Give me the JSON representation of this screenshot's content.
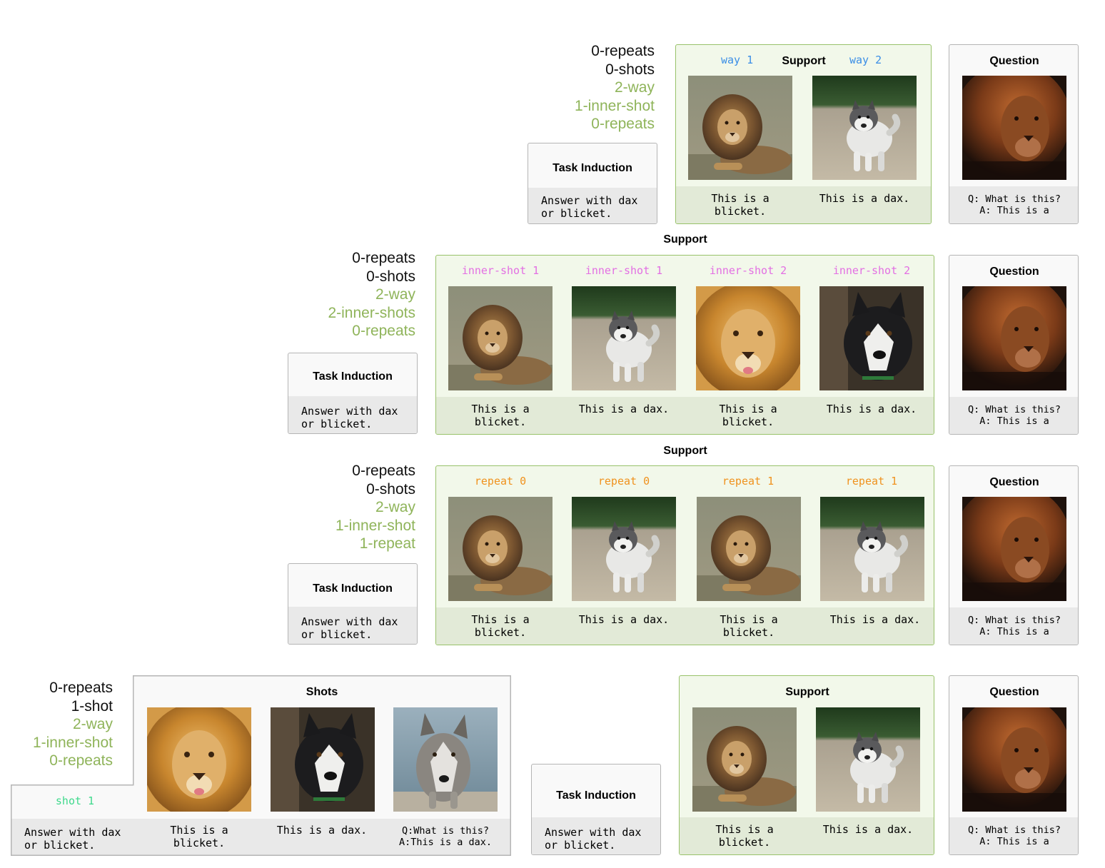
{
  "labels": {
    "support": "Support",
    "question": "Question",
    "task_induction": "Task Induction",
    "shots": "Shots"
  },
  "texts": {
    "task_induction_text": "Answer with dax\nor blicket.",
    "blicket": "This is a\nblicket.",
    "dax": "This is a dax.",
    "question_text": "Q: What is this?\nA: This is a",
    "shot_question": "Q:What is this?\nA:This is a dax."
  },
  "rows": [
    {
      "config": [
        "0-repeats",
        "0-shots",
        "2-way",
        "1-inner-shot",
        "0-repeats"
      ],
      "tags": [
        "way 1",
        "way 2"
      ]
    },
    {
      "config": [
        "0-repeats",
        "0-shots",
        "2-way",
        "2-inner-shots",
        "0-repeats"
      ],
      "tags": [
        "inner-shot 1",
        "inner-shot 1",
        "inner-shot 2",
        "inner-shot 2"
      ]
    },
    {
      "config": [
        "0-repeats",
        "0-shots",
        "2-way",
        "1-inner-shot",
        "1-repeat"
      ],
      "tags": [
        "repeat 0",
        "repeat 0",
        "repeat 1",
        "repeat 1"
      ]
    },
    {
      "config": [
        "0-repeats",
        "1-shot",
        "2-way",
        "1-inner-shot",
        "0-repeats"
      ],
      "tags": [
        "shot 1"
      ]
    }
  ],
  "images": {
    "lion_sitting": "lion-sitting-image",
    "husky_standing": "husky-standing-image",
    "lion_closeup": "lion-closeup-image",
    "husky_portrait": "husky-portrait-image",
    "wolf_dog": "wolf-dog-image",
    "lion_dark": "lion-dark-image"
  },
  "colors": {
    "support_border": "#98c26a",
    "support_fill": "#f2f8ea",
    "config_green": "#8fb45a",
    "way_blue": "#3b8ee6",
    "inner_shot_pink": "#e36fe3",
    "repeat_orange": "#f0921e",
    "shot_mint": "#3fd98c"
  }
}
